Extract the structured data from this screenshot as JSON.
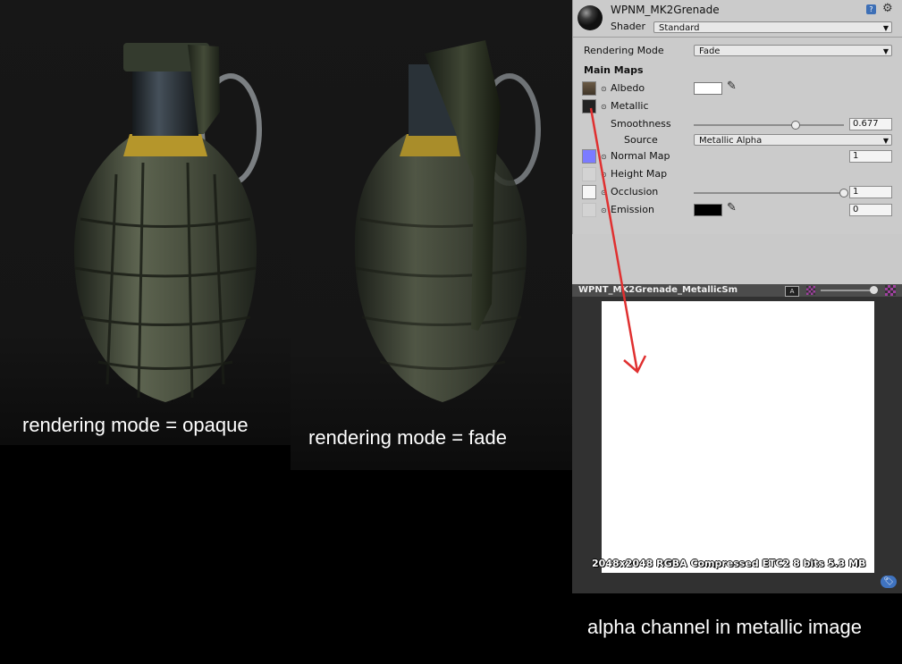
{
  "captions": {
    "opaque": "rendering mode = opaque",
    "fade": "rendering mode = fade",
    "alpha": "alpha channel in metallic image"
  },
  "inspector": {
    "material_name": "WPNM_MK2Grenade",
    "shader_label": "Shader",
    "shader_value": "Standard",
    "rendering_mode_label": "Rendering Mode",
    "rendering_mode_value": "Fade",
    "main_maps_label": "Main Maps",
    "albedo_label": "Albedo",
    "metallic_label": "Metallic",
    "smoothness_label": "Smoothness",
    "smoothness_value": "0.677",
    "smoothness_level": 0.677,
    "source_label": "Source",
    "source_value": "Metallic Alpha",
    "normal_map_label": "Normal Map",
    "normal_map_value": "1",
    "height_map_label": "Height Map",
    "occlusion_label": "Occlusion",
    "occlusion_value": "1",
    "occlusion_level": 1.0,
    "emission_label": "Emission",
    "emission_value": "0"
  },
  "preview": {
    "title": "WPNT_MK2Grenade_MetallicSm",
    "info": "2048x2048  RGBA Compressed ETC2 8 bits    5.3 MB"
  },
  "colors": {
    "albedo_swatch": "#ffffff",
    "emission_swatch": "#000000",
    "arrow": "#e03030",
    "normal_thumb": "#7b7bff"
  }
}
